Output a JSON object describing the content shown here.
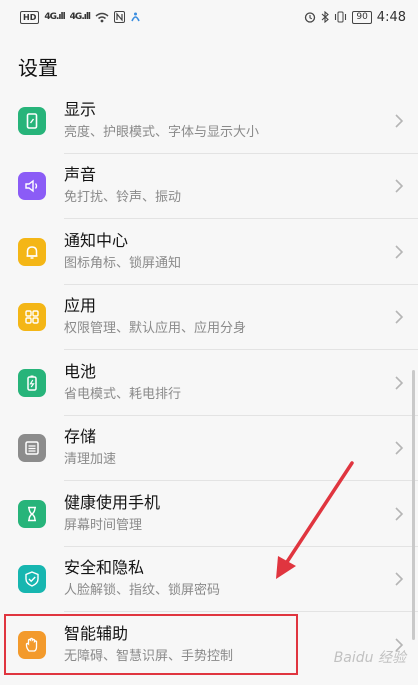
{
  "status_bar": {
    "hd": "HD",
    "signal1": "4G.ıll",
    "signal2": "4G.ıll",
    "battery": "90",
    "time": "4:48"
  },
  "page_title": "设置",
  "settings": [
    {
      "title": "显示",
      "subtitle": "亮度、护眼模式、字体与显示大小",
      "icon": "display-icon",
      "color": "#27b47a"
    },
    {
      "title": "声音",
      "subtitle": "免打扰、铃声、振动",
      "icon": "sound-icon",
      "color": "#8b5cf6"
    },
    {
      "title": "通知中心",
      "subtitle": "图标角标、锁屏通知",
      "icon": "bell-icon",
      "color": "#f4b616"
    },
    {
      "title": "应用",
      "subtitle": "权限管理、默认应用、应用分身",
      "icon": "apps-icon",
      "color": "#f4b616"
    },
    {
      "title": "电池",
      "subtitle": "省电模式、耗电排行",
      "icon": "battery-icon",
      "color": "#27b47a"
    },
    {
      "title": "存储",
      "subtitle": "清理加速",
      "icon": "storage-icon",
      "color": "#8c8c8c"
    },
    {
      "title": "健康使用手机",
      "subtitle": "屏幕时间管理",
      "icon": "hourglass-icon",
      "color": "#27b47a"
    },
    {
      "title": "安全和隐私",
      "subtitle": "人脸解锁、指纹、锁屏密码",
      "icon": "shield-icon",
      "color": "#17b6b0"
    },
    {
      "title": "智能辅助",
      "subtitle": "无障碍、智慧识屏、手势控制",
      "icon": "hand-icon",
      "color": "#f39a2c"
    }
  ],
  "annotation_color": "#e0353f",
  "watermark": "Baidu 经验"
}
